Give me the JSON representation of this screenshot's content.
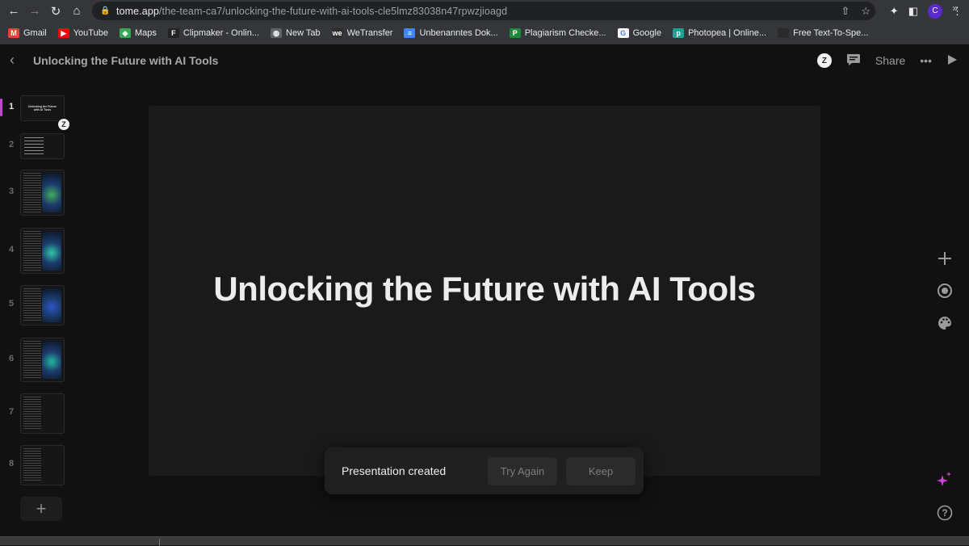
{
  "browser": {
    "url_domain": "tome.app",
    "url_path": "/the-team-ca7/unlocking-the-future-with-ai-tools-cle5lmz83038n47rpwzjioagd",
    "profile_initial": "C",
    "nav_icons": [
      "back-arrow",
      "forward-arrow",
      "reload",
      "home"
    ],
    "bookmarks": [
      {
        "label": "Gmail",
        "icon": "gmail-icon",
        "color": "#ea4335",
        "glyph": "M"
      },
      {
        "label": "YouTube",
        "icon": "youtube-icon",
        "color": "#ff0000",
        "glyph": "▶"
      },
      {
        "label": "Maps",
        "icon": "maps-icon",
        "color": "#34a853",
        "glyph": "◆"
      },
      {
        "label": "Clipmaker - Onlin...",
        "icon": "clipmaker-icon",
        "color": "#222222",
        "glyph": "F"
      },
      {
        "label": "New Tab",
        "icon": "globe-icon",
        "color": "#5f6368",
        "glyph": "◍"
      },
      {
        "label": "WeTransfer",
        "icon": "wetransfer-icon",
        "color": "#2e2e2e",
        "glyph": "we"
      },
      {
        "label": "Unbenanntes Dok...",
        "icon": "google-docs-icon",
        "color": "#4285f4",
        "glyph": "≡"
      },
      {
        "label": "Plagiarism Checke...",
        "icon": "plagiarism-checker-icon",
        "color": "#1f8a3a",
        "glyph": "P"
      },
      {
        "label": "Google",
        "icon": "google-icon",
        "color": "#ffffff",
        "glyph": "G"
      },
      {
        "label": "Photopea | Online...",
        "icon": "photopea-icon",
        "color": "#18a497",
        "glyph": "p"
      },
      {
        "label": "Free Text-To-Spe...",
        "icon": "page-icon",
        "color": "#2a2a2a",
        "glyph": ""
      }
    ],
    "bookmarks_more": "»"
  },
  "app": {
    "doc_title": "Unlocking the Future with AI Tools",
    "collaborator_initial": "Z",
    "share_label": "Share",
    "more_label": "•••"
  },
  "slides": {
    "active_index": 1,
    "items": [
      {
        "number": "1",
        "kind": "title",
        "title": "Unlocking the Future with AI Tools"
      },
      {
        "number": "2",
        "kind": "list"
      },
      {
        "number": "3",
        "kind": "text-image",
        "accent": "#3fae5a"
      },
      {
        "number": "4",
        "kind": "text-image",
        "accent": "#2fc4a6"
      },
      {
        "number": "5",
        "kind": "text-image",
        "accent": "#2b57c9"
      },
      {
        "number": "6",
        "kind": "text-image",
        "accent": "#22b89a"
      },
      {
        "number": "7",
        "kind": "text"
      },
      {
        "number": "8",
        "kind": "text"
      }
    ],
    "add_label": "+"
  },
  "canvas": {
    "slide_title": "Unlocking the Future with AI Tools"
  },
  "toast": {
    "message": "Presentation created",
    "try_again_label": "Try Again",
    "keep_label": "Keep"
  },
  "colors": {
    "accent": "#c443d6",
    "ai_sparkle": "#d63fe0"
  }
}
